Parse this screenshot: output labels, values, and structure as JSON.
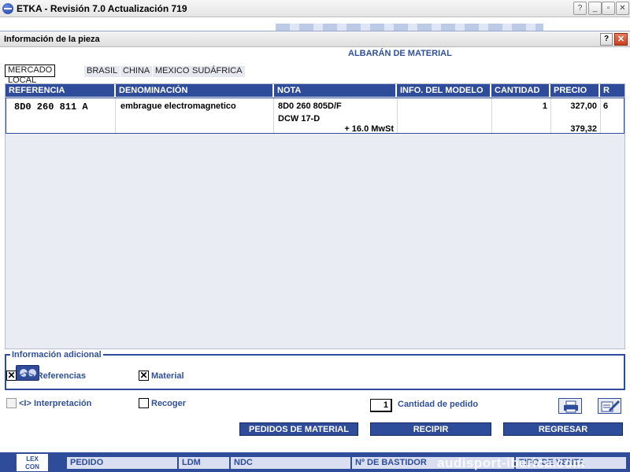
{
  "app": {
    "title": "ETKA - Revisión 7.0 Actualización 719",
    "help": "?",
    "minimize": "_",
    "restore": "▫",
    "close": "✕"
  },
  "dialog": {
    "title": "Información de la pieza",
    "help": "?",
    "close": "✕",
    "section_title": "ALBARÁN DE MATERIAL"
  },
  "tabs": [
    {
      "label": "MERCADO LOCAL",
      "active": true
    },
    {
      "label": "BRASIL",
      "active": false
    },
    {
      "label": "CHINA",
      "active": false
    },
    {
      "label": "MEXICO",
      "active": false
    },
    {
      "label": "SUDÁFRICA",
      "active": false
    }
  ],
  "table": {
    "columns": [
      "REFERENCIA",
      "DENOMINACIÓN",
      "NOTA",
      "INFO. DEL MODELO",
      "CANTIDAD",
      "PRECIO",
      "R"
    ],
    "rows": [
      {
        "referencia": "8D0 260 811 A",
        "denominacion": "embrague electromagnetico",
        "nota_1": "8D0 260 805D/F",
        "nota_2": "DCW 17-D",
        "tax_note": "+  16.0 MwSt",
        "info_modelo": "",
        "cantidad": "1",
        "precio": "327,00",
        "precio_con_iva": "379,32",
        "r": "6"
      }
    ]
  },
  "info_adicional": {
    "legend": "Información adicional",
    "button_icon": "glasses-icon"
  },
  "options": {
    "referencias": {
      "label": "<T> Referencias",
      "checked": true
    },
    "material": {
      "label": "Material",
      "checked": true
    },
    "interpretacion": {
      "label": "<I> Interpretación",
      "checked": false,
      "disabled": true
    },
    "recoger": {
      "label": "Recoger",
      "checked": false
    }
  },
  "order": {
    "quantity": "1",
    "quantity_label": "Cantidad de pedido",
    "print_icon": "printer-icon",
    "edit_icon": "edit-icon"
  },
  "actions": {
    "pedidos": "PEDIDOS DE MATERIAL",
    "recipir": "RECIPIR",
    "regresar": "REGRESAR"
  },
  "statusbar": {
    "logo_line1": "LEX",
    "logo_line2": "CON",
    "pedido": "PEDIDO",
    "ldm": "LDM",
    "ndc": "NDC",
    "bastidor": "Nº DE BASTIDOR",
    "tipo_venta": "TIPO DE VENTA",
    "watermark": "audisport-iberica.com"
  },
  "colors": {
    "accent_blue": "#2e4c9a",
    "panel_bg": "#e9ecf3"
  }
}
